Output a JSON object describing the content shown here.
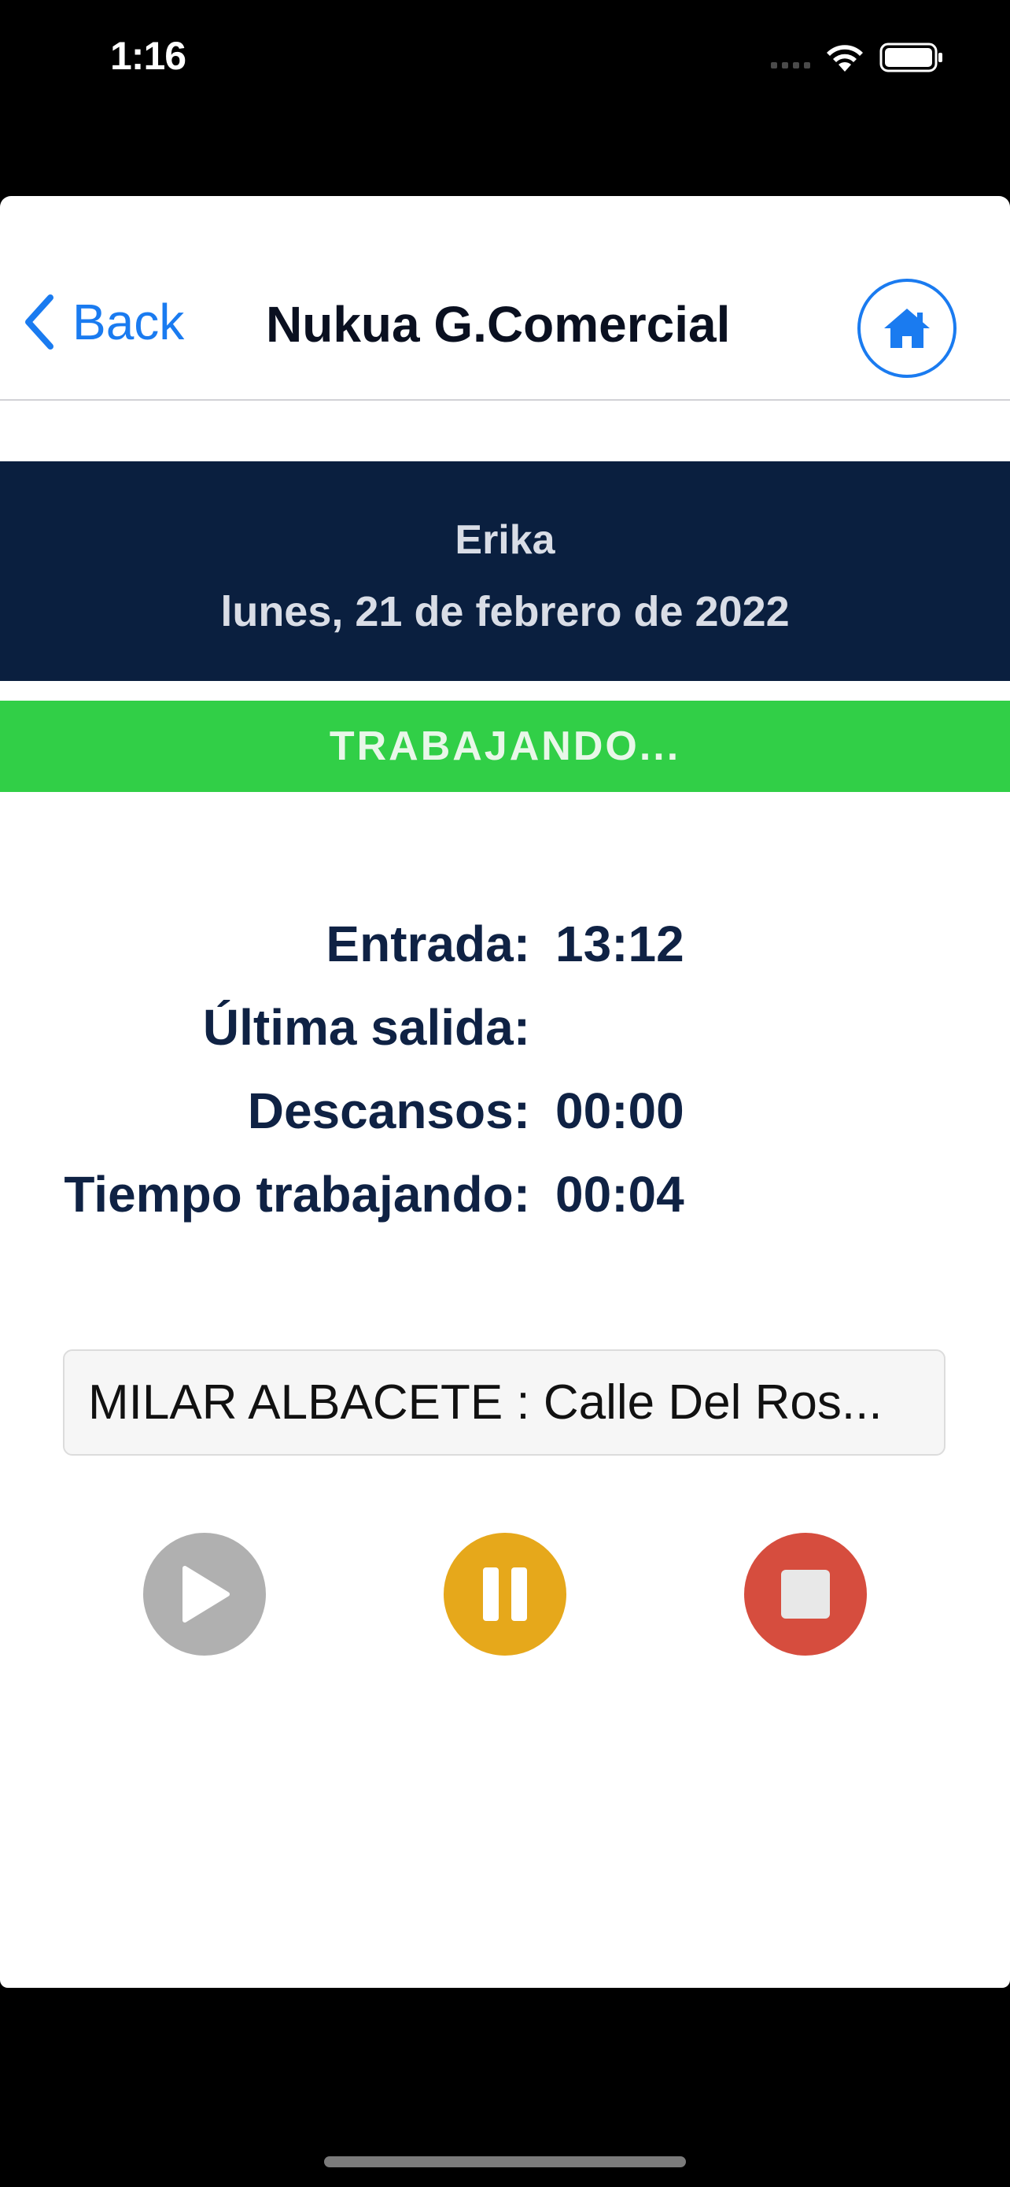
{
  "status_bar": {
    "time": "1:16",
    "icons": [
      "signal-dots-icon",
      "wifi-icon",
      "battery-icon"
    ]
  },
  "nav": {
    "back_label": "Back",
    "title": "Nukua G.Comercial",
    "home_icon": "home-icon",
    "accent_color": "#1a7bf0"
  },
  "header": {
    "name": "Erika",
    "date": "lunes, 21 de febrero de 2022",
    "background": "#0a1f3f"
  },
  "status": {
    "text": "TRABAJANDO...",
    "color": "#31cf47"
  },
  "info": {
    "rows": [
      {
        "label": "Entrada:",
        "value": "13:12"
      },
      {
        "label": "Última salida:",
        "value": ""
      },
      {
        "label": "Descansos:",
        "value": "00:00"
      },
      {
        "label": "Tiempo trabajando:",
        "value": "00:04"
      }
    ]
  },
  "location": {
    "selected": "MILAR ALBACETE : Calle Del Ros..."
  },
  "controls": {
    "play": {
      "icon": "play-icon",
      "color": "#b0b0b0",
      "enabled": false
    },
    "pause": {
      "icon": "pause-icon",
      "color": "#e6a81b"
    },
    "stop": {
      "icon": "stop-icon",
      "color": "#d64d3e"
    }
  }
}
